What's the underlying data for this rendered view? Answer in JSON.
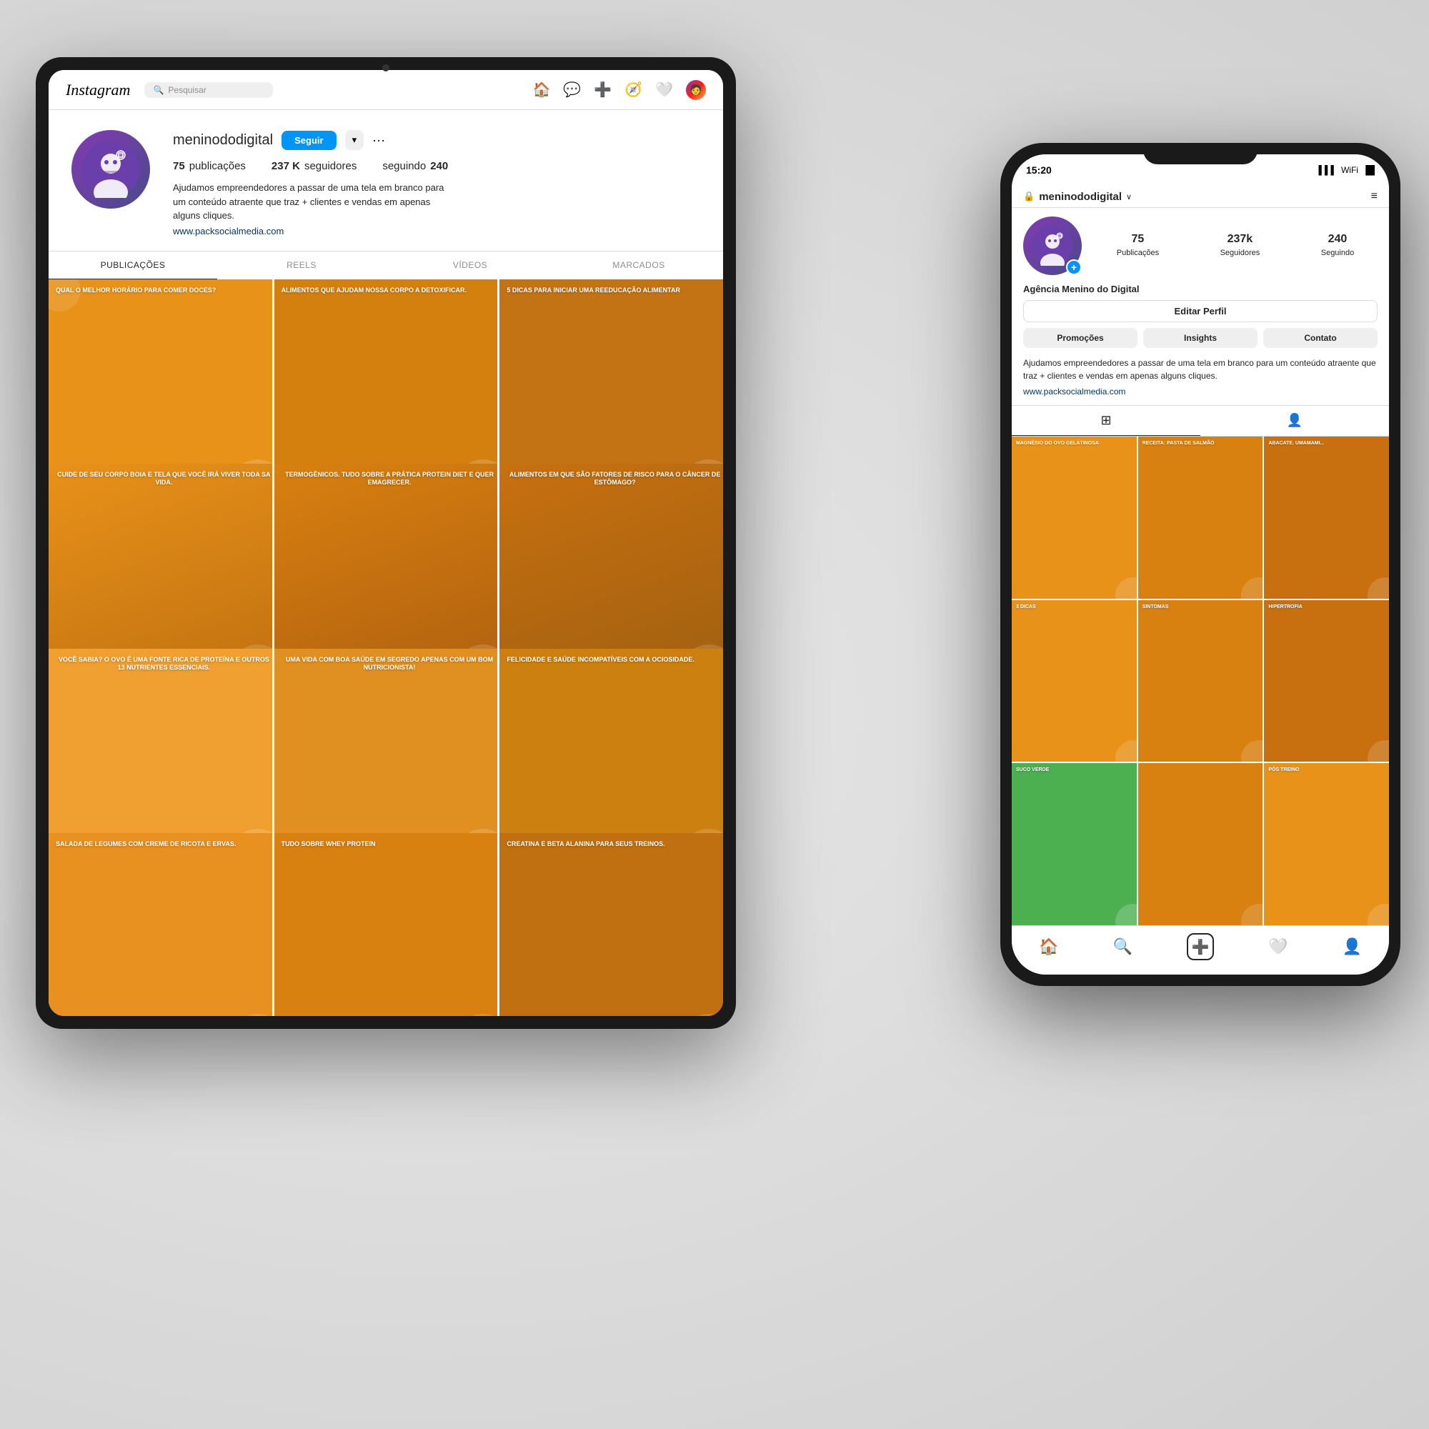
{
  "scene": {
    "background": "#e0e0e0"
  },
  "tablet": {
    "topbar": {
      "logo": "Instagram",
      "search_placeholder": "Pesquisar",
      "nav_icons": [
        "🏠",
        "💬",
        "➕",
        "❤️",
        "👤"
      ]
    },
    "profile": {
      "username": "meninododigital",
      "follow_label": "Seguir",
      "stats": [
        {
          "num": "75",
          "label": "publicações"
        },
        {
          "num": "237 K",
          "label": "seguidores"
        },
        {
          "num": "240",
          "label": "seguindo"
        }
      ],
      "bio": "Ajudamos empreendedores a passar de uma tela em branco\npara um conteúdo atraente que traz + clientes e vendas em\napenas alguns cliques.",
      "link": "www.packsocialmedia.com"
    },
    "tabs": [
      {
        "label": "PUBLICAÇÕES",
        "active": true
      },
      {
        "label": "REELS",
        "active": false
      },
      {
        "label": "VÍDEOS",
        "active": false
      },
      {
        "label": "MARCADOS",
        "active": false
      }
    ],
    "grid": [
      {
        "text": "QUAL O\nMELHOR\nHORÁRIO\npara comer\ndoces?",
        "color": "#e8921a"
      },
      {
        "text": "ALIMENTOS\nque ajudam\nnossa corpo a\ndetoxificar.",
        "color": "#e0881a"
      },
      {
        "text": "5 DICAS\npara iniciar\numa reeducação\nalimentar",
        "color": "#d4800f"
      },
      {
        "text": "CUIDE DE\nSEU CORPO\nboia e tela\nque você irá\nviver toda\nsa vida.",
        "color": "#e8921a"
      },
      {
        "text": "TERMOGÊNICOS.\nTudo sobre a\nprática\nprotein diet\ne quer\nemagrecer.",
        "color": "#d88010"
      },
      {
        "text": "ALIMENTOS\nem que são\nfatores de\nrisco para o\ncâncer de\nestômago?",
        "color": "#c87010"
      },
      {
        "text": "VOCÊ SABIA?\nO ovo é uma\nfonte rica de\nproteína e\noutros 13\nnutrientes\nessenciais.",
        "color": "#e8921a"
      },
      {
        "text": "UMA VIDA COM\nBOA SAÚDE\nEm segredo\napenas com\num bom\nnutricionista!",
        "color": "#d88010"
      },
      {
        "text": "FELICIDADE\nE SAÚDE\nIncompatíveis\ncom a\nociosidade.",
        "color": "#c87010"
      },
      {
        "text": "SALADA DE\nLEGUMES\ncom creme\nde ricota e\nervas.",
        "color": "#e8921a"
      },
      {
        "text": "TUDO\nsobre\nWhey\nProtein",
        "color": "#d88010"
      },
      {
        "text": "CREATINA E\nBETA ALANINA\npara seus\ntreinos.",
        "color": "#c87010"
      }
    ]
  },
  "phone": {
    "status_bar": {
      "time": "15:20",
      "icons": [
        "📶",
        "📡",
        "🔋"
      ]
    },
    "header": {
      "lock_icon": "🔒",
      "username": "meninododigital",
      "chevron": "∨",
      "menu_icon": "≡"
    },
    "profile": {
      "display_name": "Agência Menino do Digital",
      "stats": [
        {
          "num": "75",
          "label": "Publicações"
        },
        {
          "num": "237k",
          "label": "Seguidores"
        },
        {
          "num": "240",
          "label": "Seguindo"
        }
      ],
      "edit_label": "Editar Perfil",
      "action_buttons": [
        {
          "label": "Promoções"
        },
        {
          "label": "Insights"
        },
        {
          "label": "Contato"
        }
      ],
      "bio": "Ajudamos empreendedores a passar de uma tela em branco\npara um conteúdo atraente que traz + clientes e vendas em\napenas alguns cliques.",
      "link": "www.packsocialmedia.com"
    },
    "grid_tabs": [
      {
        "icon": "⊞",
        "active": true
      },
      {
        "icon": "👤",
        "active": false
      }
    ],
    "grid": [
      {
        "text": "MAGNÉSIO\ndo ovo\ngelátinosa",
        "color": "#e8921a"
      },
      {
        "text": "RECEITA:\npasta de\nsalmão",
        "color": "#d88010"
      },
      {
        "text": "ABACATE.\numamami...",
        "color": "#c87010"
      },
      {
        "text": "3 DICAS",
        "color": "#e8921a"
      },
      {
        "text": "SINTOMAS",
        "color": "#d88010"
      },
      {
        "text": "HIPERTROFIA",
        "color": "#c87010"
      },
      {
        "text": "SUCO\nVERDE",
        "color": "#4caf50"
      },
      {
        "text": "",
        "color": "#d88010"
      },
      {
        "text": "PÓS\nTREINO",
        "color": "#e8921a"
      }
    ],
    "bottom_nav": [
      "🏠",
      "🔍",
      "➕",
      "❤️",
      "👤"
    ]
  }
}
